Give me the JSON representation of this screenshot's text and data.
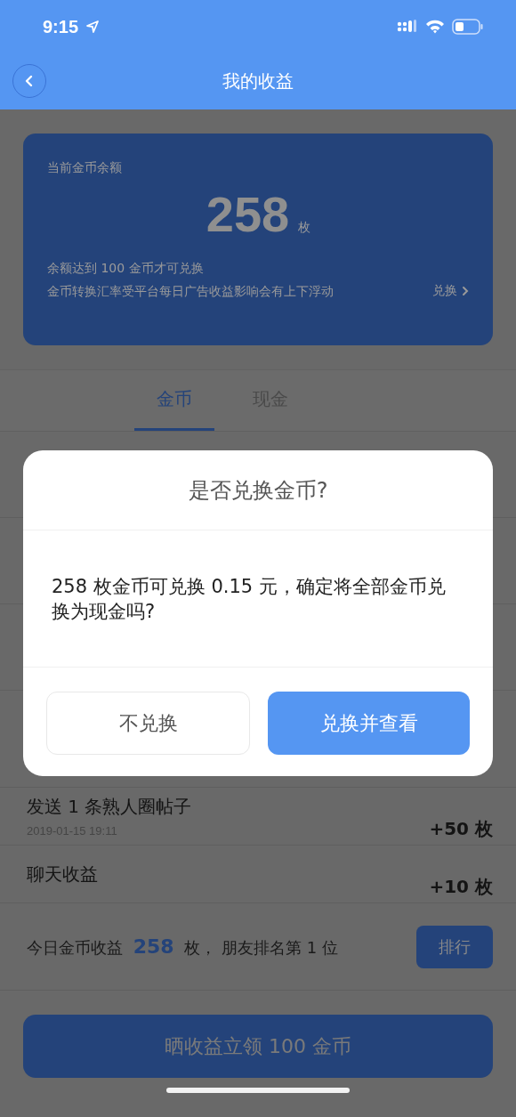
{
  "status_bar": {
    "time": "9:15"
  },
  "nav": {
    "title": "我的收益"
  },
  "balance_card": {
    "label": "当前金币余额",
    "amount": "258",
    "unit": "枚",
    "note": "余额达到 100 金币才可兑换",
    "disclaimer": "金币转换汇率受平台每日广告收益影响会有上下浮动",
    "action": "兑换"
  },
  "tabs": [
    {
      "label": "金币",
      "selected": true
    },
    {
      "label": "现金",
      "selected": false
    }
  ],
  "records": [
    {
      "title": "发送 1 条熟人圈帖子",
      "date": "2019-01-15 19:11",
      "amount": "+50 枚"
    },
    {
      "title": "聊天收益",
      "amount": "+10 枚"
    }
  ],
  "today": {
    "prefix": "今日金币收益",
    "value": "258",
    "suffix": "枚， 朋友排名第 1 位",
    "button": "排行"
  },
  "share_button": "晒收益立领 100 金币",
  "dialog": {
    "title": "是否兑换金币?",
    "message": "258 枚金币可兑换 0.15 元，确定将全部金币兑换为现金吗?",
    "buttons": [
      {
        "label": "不兑换",
        "kind": "secondary"
      },
      {
        "label": "兑换并查看",
        "kind": "primary"
      }
    ]
  }
}
